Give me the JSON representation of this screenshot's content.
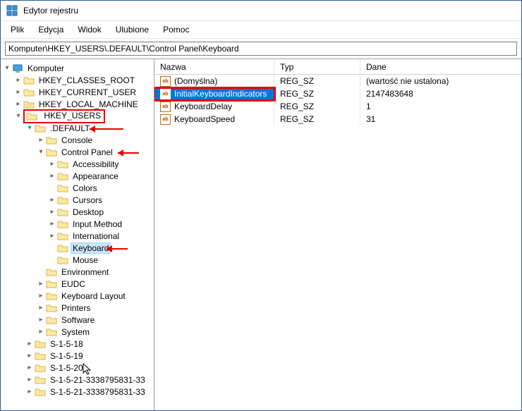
{
  "title": "Edytor rejestru",
  "menu": [
    "Plik",
    "Edycja",
    "Widok",
    "Ulubione",
    "Pomoc"
  ],
  "address": "Komputer\\HKEY_USERS\\.DEFAULT\\Control Panel\\Keyboard",
  "tree": {
    "root": "Komputer",
    "hives": {
      "hkcr": "HKEY_CLASSES_ROOT",
      "hkcu": "HKEY_CURRENT_USER",
      "hklm": "HKEY_LOCAL_MACHINE",
      "hku": "HKEY_USERS"
    },
    "default": ".DEFAULT",
    "default_children1": [
      "Console"
    ],
    "control_panel": "Control Panel",
    "cp_children": [
      "Accessibility",
      "Appearance",
      "Colors",
      "Cursors",
      "Desktop",
      "Input Method",
      "International",
      "Keyboard",
      "Mouse"
    ],
    "default_children2": [
      "Environment",
      "EUDC",
      "Keyboard Layout",
      "Printers",
      "Software",
      "System"
    ],
    "sids": [
      "S-1-5-18",
      "S-1-5-19",
      "S-1-5-20",
      "S-1-5-21-3338795831-33",
      "S-1-5-21-3338795831-33"
    ]
  },
  "list": {
    "headers": {
      "name": "Nazwa",
      "type": "Typ",
      "data": "Dane"
    },
    "rows": [
      {
        "name": "(Domyślna)",
        "type": "REG_SZ",
        "data": "(wartość nie ustalona)"
      },
      {
        "name": "InitialKeyboardIndicators",
        "type": "REG_SZ",
        "data": "2147483648",
        "selected": true,
        "highlight": true
      },
      {
        "name": "KeyboardDelay",
        "type": "REG_SZ",
        "data": "1"
      },
      {
        "name": "KeyboardSpeed",
        "type": "REG_SZ",
        "data": "31"
      }
    ]
  },
  "icons": {
    "ab": "ab"
  }
}
